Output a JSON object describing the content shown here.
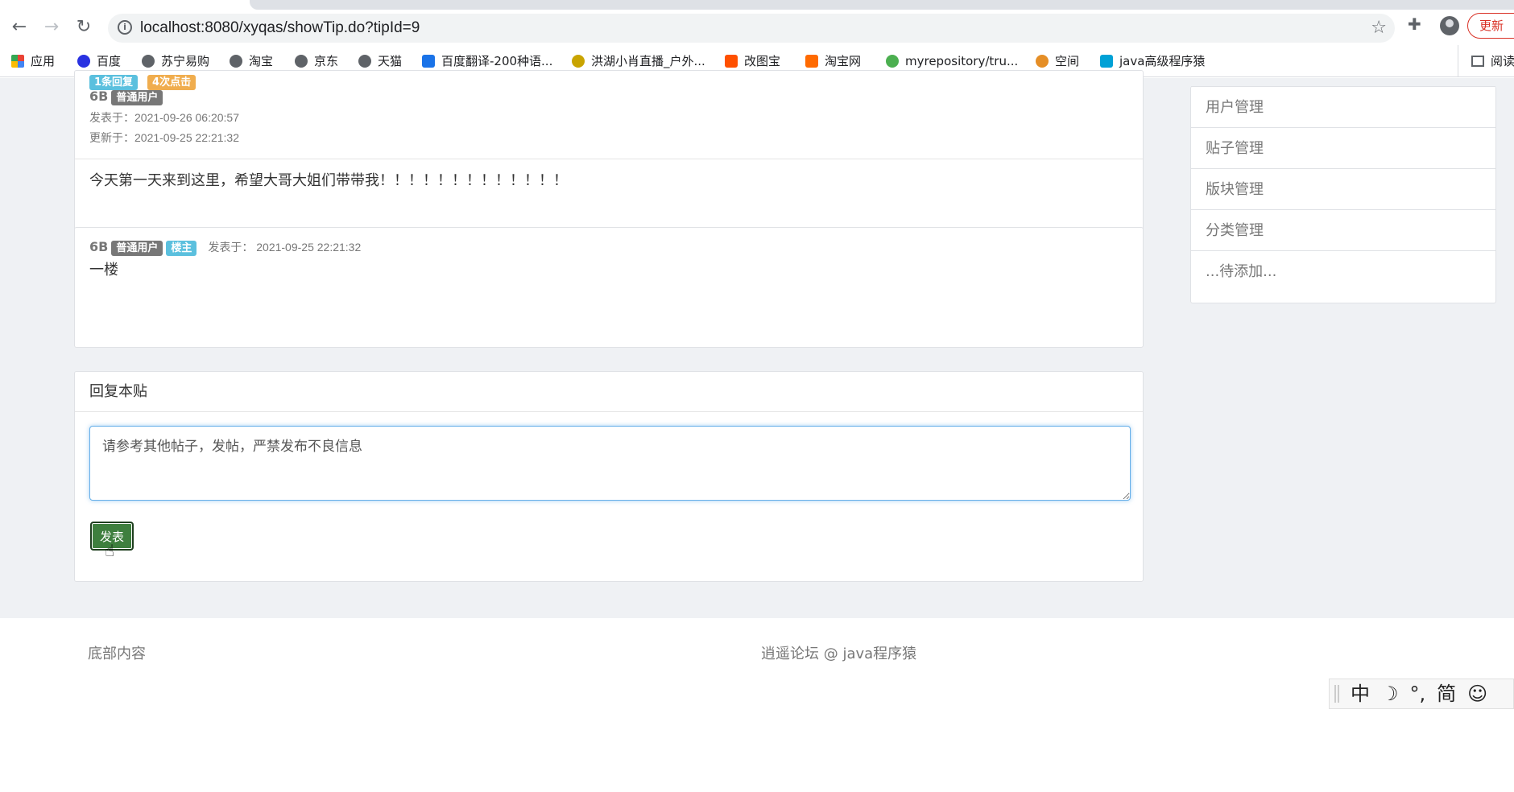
{
  "browser": {
    "url": "localhost:8080/xyqas/showTip.do?tipId=9",
    "update_label": "更新",
    "bookmarks": [
      "应用",
      "百度",
      "苏宁易购",
      "淘宝",
      "京东",
      "天猫",
      "百度翻译-200种语...",
      "洪湖小肖直播_户外...",
      "改图宝",
      "淘宝网",
      "myrepository/tru...",
      "空间",
      "java高级程序猿"
    ],
    "reading_list": "阅读清"
  },
  "post": {
    "reply_count": "1条回复",
    "click_count": "4次点击",
    "author": "6B",
    "role": "普通用户",
    "published": "发表于：2021-09-26 06:20:57",
    "updated": "更新于：2021-09-25 22:21:32",
    "content": "今天第一天来到这里，希望大哥大姐们带带我！！！！！！！！！！！！！"
  },
  "reply": {
    "author": "6B",
    "role": "普通用户",
    "owner_badge": "楼主",
    "published": "发表于： 2021-09-25 22:21:32",
    "content": "一楼"
  },
  "reply_form": {
    "title": "回复本贴",
    "placeholder": "请参考其他帖子，发帖，严禁发布不良信息",
    "submit_label": "发表"
  },
  "sidebar": {
    "items": [
      "用户管理",
      "贴子管理",
      "版块管理",
      "分类管理",
      "...待添加..."
    ]
  },
  "footer": {
    "left": "底部内容",
    "center": "逍遥论坛 @ java程序猿"
  },
  "ime": {
    "keys": [
      "中",
      "☽",
      "°,",
      "简",
      "☺"
    ]
  }
}
